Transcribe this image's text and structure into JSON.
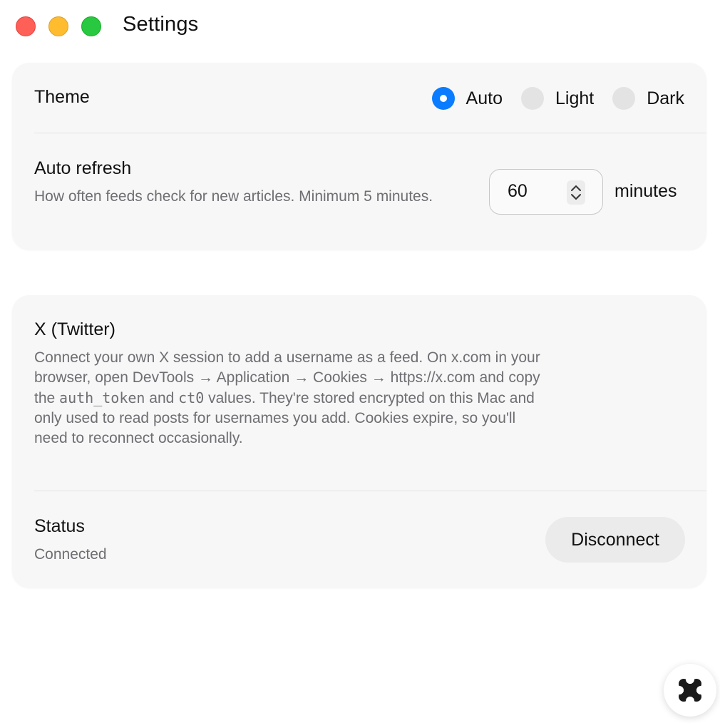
{
  "window": {
    "title": "Settings"
  },
  "general": {
    "theme": {
      "label": "Theme",
      "options": [
        {
          "label": "Auto",
          "selected": true
        },
        {
          "label": "Light",
          "selected": false
        },
        {
          "label": "Dark",
          "selected": false
        }
      ]
    },
    "auto_refresh": {
      "label": "Auto refresh",
      "description": "How often feeds check for new articles. Minimum 5 minutes.",
      "value": "60",
      "unit": "minutes"
    }
  },
  "twitter": {
    "title": "X (Twitter)",
    "description": {
      "part1": "Connect your own X session to add a username as a feed. On x.com in your browser, open DevTools → Application → Cookies → https://x.com and copy the ",
      "code1": "auth_token",
      "part2": " and ",
      "code2": "ct0",
      "part3": " values. They're stored encrypted on this Mac and only used to read posts for usernames you add. Cookies expire, so you'll need to reconnect occasionally."
    },
    "status": {
      "label": "Status",
      "value": "Connected"
    },
    "disconnect_label": "Disconnect"
  },
  "colors": {
    "accent": "#0a7cff",
    "card_background": "#f7f7f7",
    "secondary_text": "#6e6e73"
  },
  "icons": {
    "stepper": "chevron-up-down-icon",
    "fab": "four-petal-logo-icon"
  }
}
